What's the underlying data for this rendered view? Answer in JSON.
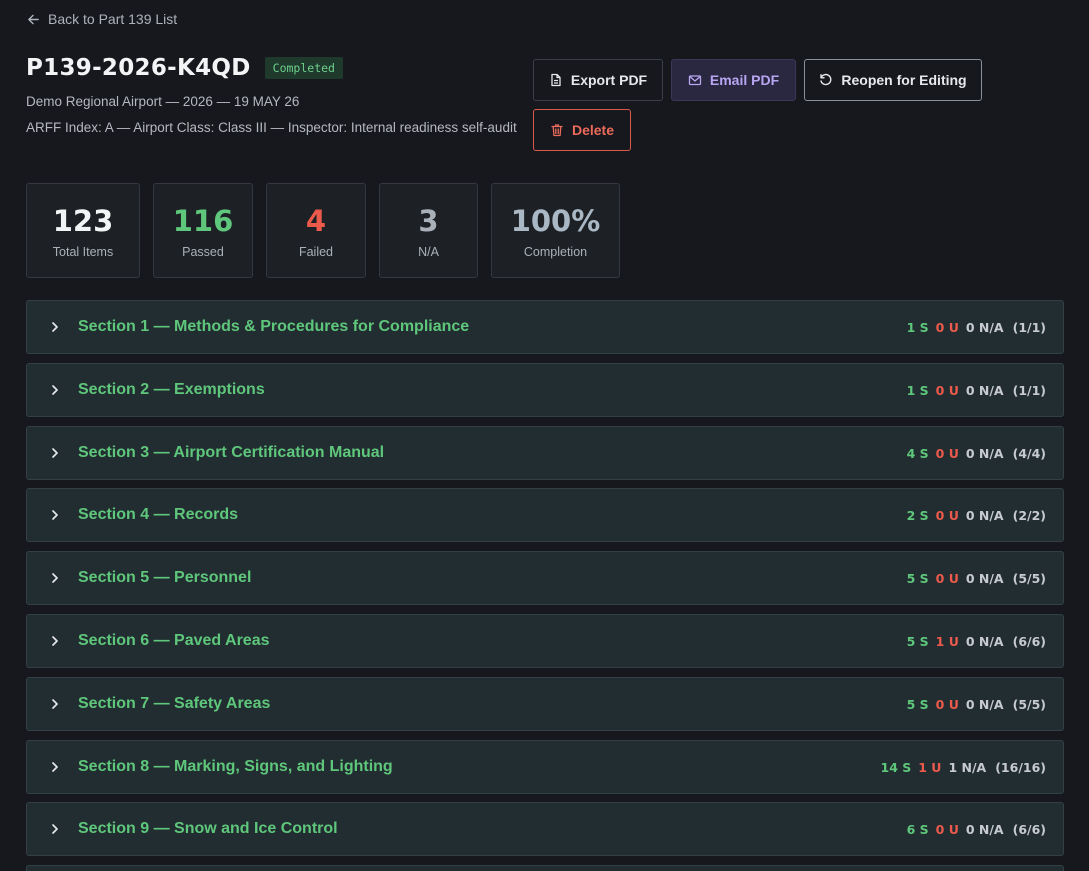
{
  "back_link": {
    "label": "Back to Part 139 List"
  },
  "header": {
    "title": "P139-2026-K4QD",
    "status": "Completed",
    "meta_line1": "Demo Regional Airport — 2026 — 19 MAY 26",
    "meta_line2": "ARFF Index: A — Airport Class: Class III — Inspector: Internal readiness self-audit"
  },
  "actions": {
    "export_pdf": "Export PDF",
    "email_pdf": "Email PDF",
    "reopen": "Reopen for Editing",
    "delete": "Delete"
  },
  "colors": {
    "passed": "#5ec77b",
    "failed": "#ec5a4c",
    "neutral": "#c7cbd0",
    "email_accent": "#b9a6f2"
  },
  "stats": [
    {
      "value": "123",
      "label": "Total Items",
      "color": "#f3f4f6"
    },
    {
      "value": "116",
      "label": "Passed",
      "color": "#5ec77b"
    },
    {
      "value": "4",
      "label": "Failed",
      "color": "#ec5a4c"
    },
    {
      "value": "3",
      "label": "N/A",
      "color": "#aab0b7"
    },
    {
      "value": "100%",
      "label": "Completion",
      "color": "#aab8c6"
    }
  ],
  "sections": [
    {
      "title": "Section 1 — Methods & Procedures for Compliance",
      "s": "1 S",
      "u": "0 U",
      "na": "0 N/A",
      "ratio": "(1/1)"
    },
    {
      "title": "Section 2 — Exemptions",
      "s": "1 S",
      "u": "0 U",
      "na": "0 N/A",
      "ratio": "(1/1)"
    },
    {
      "title": "Section 3 — Airport Certification Manual",
      "s": "4 S",
      "u": "0 U",
      "na": "0 N/A",
      "ratio": "(4/4)"
    },
    {
      "title": "Section 4 — Records",
      "s": "2 S",
      "u": "0 U",
      "na": "0 N/A",
      "ratio": "(2/2)"
    },
    {
      "title": "Section 5 — Personnel",
      "s": "5 S",
      "u": "0 U",
      "na": "0 N/A",
      "ratio": "(5/5)"
    },
    {
      "title": "Section 6 — Paved Areas",
      "s": "5 S",
      "u": "1 U",
      "na": "0 N/A",
      "ratio": "(6/6)"
    },
    {
      "title": "Section 7 — Safety Areas",
      "s": "5 S",
      "u": "0 U",
      "na": "0 N/A",
      "ratio": "(5/5)"
    },
    {
      "title": "Section 8 — Marking, Signs, and Lighting",
      "s": "14 S",
      "u": "1 U",
      "na": "1 N/A",
      "ratio": "(16/16)"
    },
    {
      "title": "Section 9 — Snow and Ice Control",
      "s": "6 S",
      "u": "0 U",
      "na": "0 N/A",
      "ratio": "(6/6)"
    }
  ]
}
